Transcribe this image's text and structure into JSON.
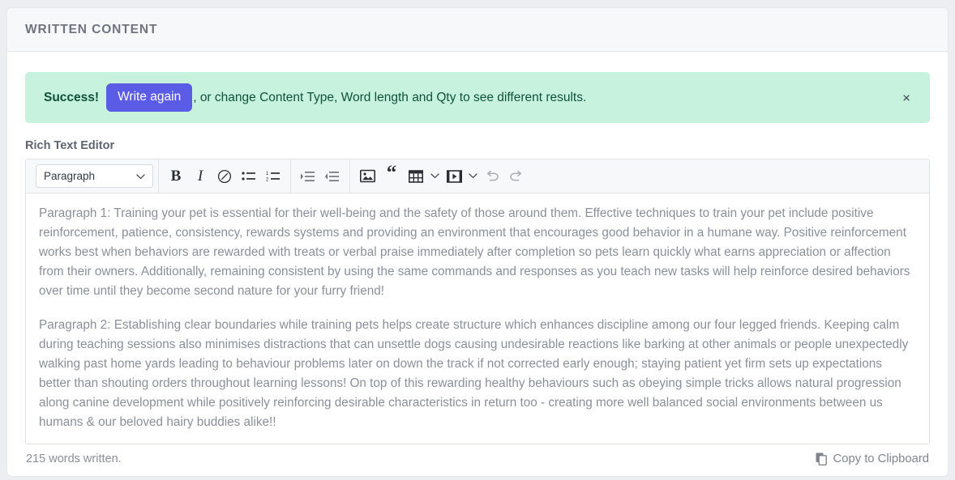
{
  "card": {
    "title": "WRITTEN CONTENT"
  },
  "alert": {
    "strong": "Success!",
    "button_label": "Write again",
    "message": ", or change Content Type, Word length and Qty to see different results.",
    "close_label": "×",
    "background_color": "#c6f2de",
    "text_color": "#11523b",
    "button_color": "#5a5ce6"
  },
  "editor": {
    "label": "Rich Text Editor",
    "toolbar": {
      "style_select": {
        "value": "Paragraph",
        "chevron": "chevron-down"
      },
      "groups": [
        {
          "items": [
            {
              "name": "bold",
              "label": "B"
            },
            {
              "name": "italic",
              "label": "I"
            },
            {
              "name": "link",
              "label": "link-icon"
            },
            {
              "name": "bulleted-list",
              "label": "bulleted-list-icon"
            },
            {
              "name": "numbered-list",
              "label": "numbered-list-icon"
            }
          ]
        },
        {
          "items": [
            {
              "name": "indent",
              "label": "indent-icon"
            },
            {
              "name": "outdent",
              "label": "outdent-icon"
            }
          ]
        },
        {
          "items": [
            {
              "name": "image",
              "label": "image-icon"
            },
            {
              "name": "blockquote",
              "label": "“"
            },
            {
              "name": "table",
              "label": "table-icon"
            },
            {
              "name": "media",
              "label": "video-icon"
            },
            {
              "name": "undo",
              "label": "undo-icon"
            },
            {
              "name": "redo",
              "label": "redo-icon"
            }
          ]
        }
      ]
    },
    "content": {
      "paragraph_1": "Paragraph 1: Training your pet is essential for their well-being and the safety of those around them. Effective techniques to train your pet include positive reinforcement, patience, consistency, rewards systems and providing an environment that encourages good behavior in a humane way. Positive reinforcement works best when behaviors are rewarded with treats or verbal praise immediately after completion so pets learn quickly what earns appreciation or affection from their owners. Additionally, remaining consistent by using the same commands and responses as you teach new tasks will help reinforce desired behaviors over time until they become second nature for your furry friend!",
      "paragraph_2": "Paragraph 2: Establishing clear boundaries while training pets helps create structure which enhances discipline among our four legged friends. Keeping calm during teaching sessions also minimises distractions that can unsettle dogs causing undesirable reactions like barking at other animals or people unexpectedly walking past home yards leading to behaviour problems later on down the track if not corrected early enough; staying patient yet firm sets up expectations better than shouting orders throughout learning lessons! On top of this rewarding healthy behaviours such as obeying simple tricks allows natural progression along canine development while positively reinforcing desirable characteristics in return too - creating more well balanced social environments between us humans & our beloved hairy buddies alike!!"
    }
  },
  "footer": {
    "word_count": "215 words written.",
    "copy_label": "Copy to Clipboard"
  }
}
